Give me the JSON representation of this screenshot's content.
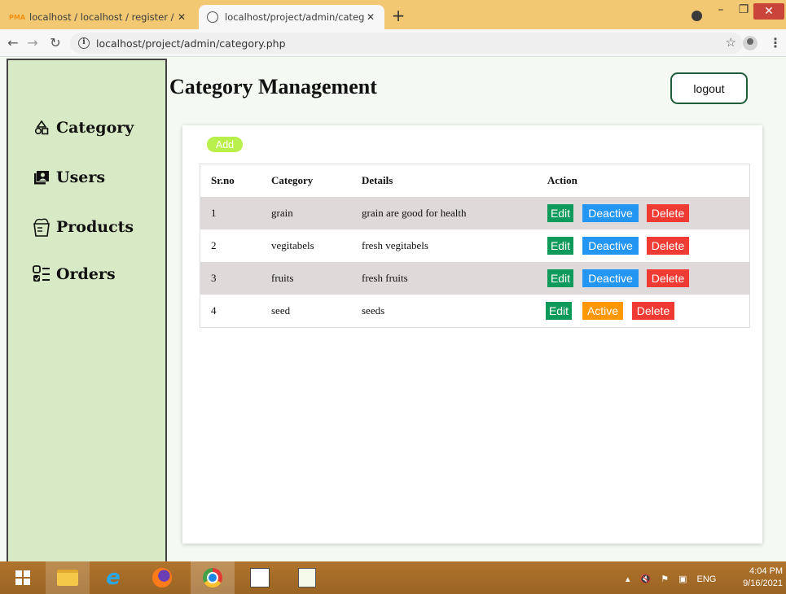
{
  "browser": {
    "tabs": [
      {
        "title": "localhost / localhost / register / s",
        "favicon": "phpmyadmin-icon"
      },
      {
        "title": "localhost/project/admin/category",
        "favicon": "globe-icon"
      }
    ],
    "url": "localhost/project/admin/category.php"
  },
  "sidebar": {
    "items": [
      {
        "label": "Category",
        "icon": "category-icon"
      },
      {
        "label": "Users",
        "icon": "users-icon"
      },
      {
        "label": "Products",
        "icon": "products-icon"
      },
      {
        "label": "Orders",
        "icon": "orders-icon"
      }
    ]
  },
  "main": {
    "title": "Category Management",
    "logout_label": "logout",
    "add_label": "Add"
  },
  "table": {
    "headers": [
      "Sr.no",
      "Category",
      "Details",
      "Action"
    ],
    "rows": [
      {
        "sr": "1",
        "category": "grain",
        "details": "grain are good for health",
        "edit": "Edit",
        "status": "Deactive",
        "delete": "Delete"
      },
      {
        "sr": "2",
        "category": "vegitabels",
        "details": "fresh vegitabels",
        "edit": "Edit",
        "status": "Deactive",
        "delete": "Delete"
      },
      {
        "sr": "3",
        "category": "fruits",
        "details": "fresh fruits",
        "edit": "Edit",
        "status": "Deactive",
        "delete": "Delete"
      },
      {
        "sr": "4",
        "category": "seed",
        "details": "seeds",
        "edit": "Edit",
        "status": "Active",
        "delete": "Delete"
      }
    ]
  },
  "colors": {
    "sidebar_bg": "#d7eac5",
    "edit": "#0e9a5b",
    "deactive": "#2396f3",
    "active": "#ff9800",
    "delete": "#ef3b33",
    "add": "#b9ef4b"
  },
  "taskbar": {
    "language": "ENG",
    "time": "4:04 PM",
    "date": "9/16/2021"
  }
}
